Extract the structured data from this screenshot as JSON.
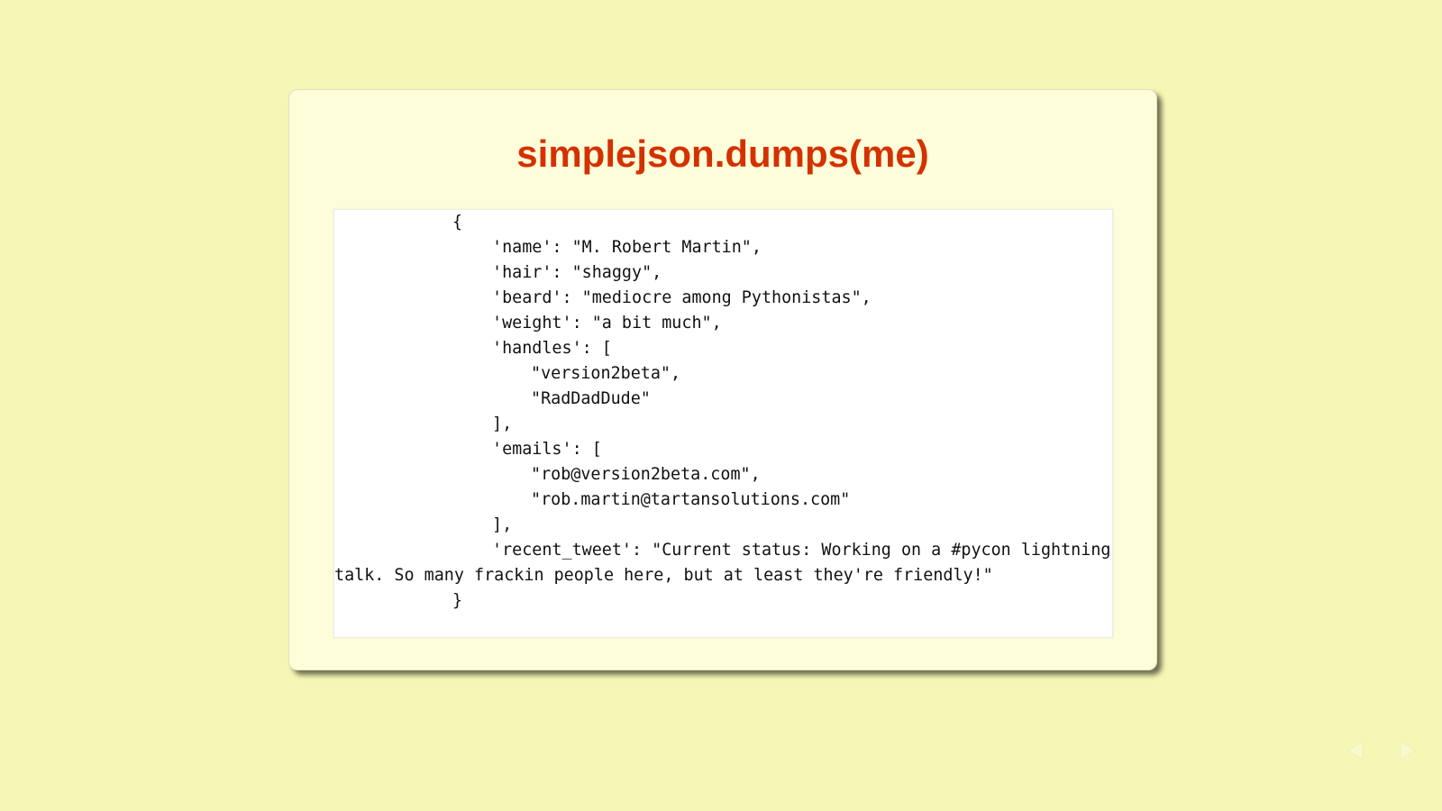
{
  "slide": {
    "title": "simplejson.dumps(me)",
    "code_lines": [
      "{",
      "'name': \"M. Robert Martin\",",
      "'hair': \"shaggy\",",
      "'beard': \"mediocre among Pythonistas\",",
      "'weight': \"a bit much\",",
      "'handles': [",
      "\"version2beta\",",
      "\"RadDadDude\"",
      "],",
      "'emails': [",
      "\"rob@version2beta.com\",",
      "\"rob.martin@tartansolutions.com\"",
      "],",
      "'recent_tweet': \"Current status: Working on a #pycon lightning",
      "talk. So many frackin people here, but at least they're friendly!\"",
      "}"
    ]
  },
  "navigation": {
    "prev_icon": "triangle-left-icon",
    "next_icon": "triangle-right-icon"
  },
  "colors": {
    "background": "#f6f6b5",
    "slide": "#fdfdd9",
    "title": "#d43100"
  }
}
